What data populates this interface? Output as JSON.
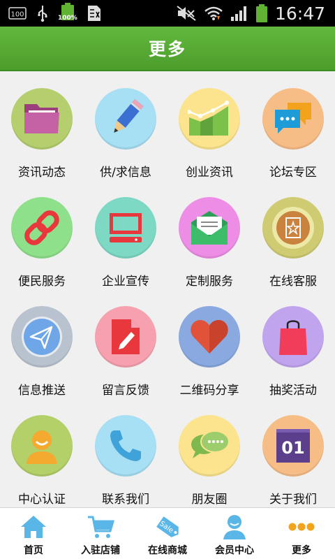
{
  "status_bar": {
    "left_icons": [
      "sim-100-icon",
      "usb-icon",
      "battery-100-icon",
      "sd-card-icon"
    ],
    "battery_percent_label": "100%",
    "sim_label": "100",
    "right_icons": [
      "mute-icon",
      "wifi-icon",
      "signal-icon",
      "battery-icon"
    ],
    "time": "16:47"
  },
  "header": {
    "title": "更多"
  },
  "grid": {
    "items": [
      {
        "label": "资讯动态",
        "icon": "folder-icon",
        "bg": "#b5cf6e"
      },
      {
        "label": "供/求信息",
        "icon": "pencil-icon",
        "bg": "#a7dff4"
      },
      {
        "label": "创业资讯",
        "icon": "growth-chart-icon",
        "bg": "#fbe48d"
      },
      {
        "label": "论坛专区",
        "icon": "chat-bubbles-icon",
        "bg": "#f7bd86"
      },
      {
        "label": "便民服务",
        "icon": "link-icon",
        "bg": "#8fe08a"
      },
      {
        "label": "企业宣传",
        "icon": "monitor-icon",
        "bg": "#7dd8c4"
      },
      {
        "label": "定制服务",
        "icon": "envelope-icon",
        "bg": "#ee8de6"
      },
      {
        "label": "在线客服",
        "icon": "service-badge-icon",
        "bg": "#cfcb72"
      },
      {
        "label": "信息推送",
        "icon": "paper-plane-icon",
        "bg": "#b9c3cf"
      },
      {
        "label": "留言反馈",
        "icon": "feedback-doc-icon",
        "bg": "#f7a1b0"
      },
      {
        "label": "二维码分享",
        "icon": "heart-icon",
        "bg": "#89a9e0"
      },
      {
        "label": "抽奖活动",
        "icon": "shopping-bag-icon",
        "bg": "#c0a4ee"
      },
      {
        "label": "中心认证",
        "icon": "user-icon",
        "bg": "#b3d069"
      },
      {
        "label": "联系我们",
        "icon": "phone-icon",
        "bg": "#a7dff4"
      },
      {
        "label": "朋友圈",
        "icon": "speech-bubbles-icon",
        "bg": "#fbe48d"
      },
      {
        "label": "关于我们",
        "icon": "calendar-icon",
        "bg": "#f7bd86",
        "icon_text": "01"
      }
    ]
  },
  "bottom_nav": {
    "items": [
      {
        "label": "首页",
        "icon": "home-icon"
      },
      {
        "label": "入驻店铺",
        "icon": "cart-icon"
      },
      {
        "label": "在线商城",
        "icon": "sale-tag-icon",
        "icon_text": "Sale"
      },
      {
        "label": "会员中心",
        "icon": "member-icon"
      },
      {
        "label": "更多",
        "icon": "more-dots-icon"
      }
    ]
  }
}
